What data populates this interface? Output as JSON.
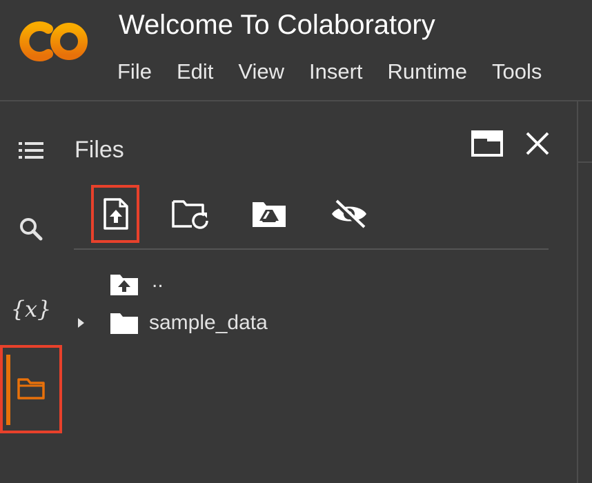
{
  "app": {
    "title": "Welcome To Colaboratory",
    "logo_text": "CO"
  },
  "menu": {
    "items": [
      "File",
      "Edit",
      "View",
      "Insert",
      "Runtime",
      "Tools"
    ]
  },
  "sidebar": {
    "items": [
      {
        "name": "table-of-contents",
        "icon": "list-icon"
      },
      {
        "name": "search",
        "icon": "search-icon"
      },
      {
        "name": "variables",
        "icon": "variables-icon",
        "label": "{x}"
      },
      {
        "name": "files",
        "icon": "folder-icon",
        "active": true
      }
    ]
  },
  "files_panel": {
    "title": "Files",
    "toolbar": [
      {
        "name": "upload-file",
        "icon": "upload-file-icon",
        "highlighted": true
      },
      {
        "name": "refresh",
        "icon": "folder-refresh-icon"
      },
      {
        "name": "mount-drive",
        "icon": "google-drive-folder-icon"
      },
      {
        "name": "toggle-hidden",
        "icon": "eye-off-icon"
      }
    ],
    "tree": [
      {
        "label": "..",
        "icon": "folder-up-icon"
      },
      {
        "label": "sample_data",
        "icon": "folder-icon",
        "expandable": true
      }
    ]
  },
  "colors": {
    "background": "#383838",
    "accent": "#e8710a",
    "highlight_border": "#e8412b",
    "text": "#e3e3e3"
  }
}
